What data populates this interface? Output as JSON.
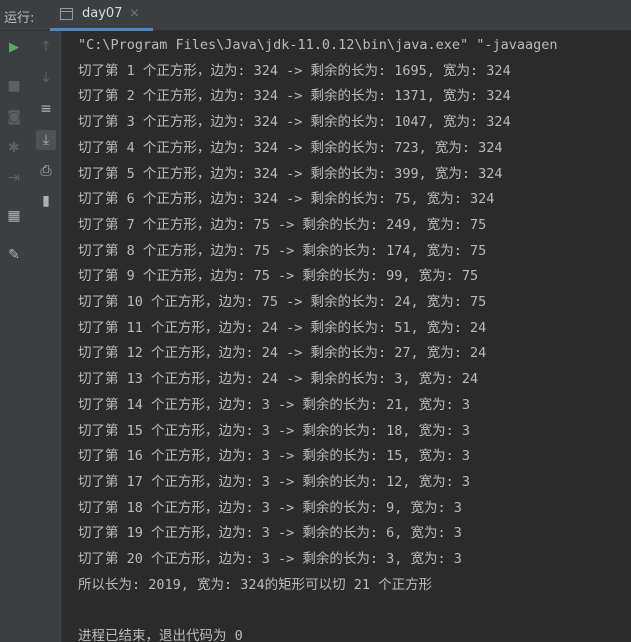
{
  "toolbar": {
    "run_label": "运行:",
    "tab_label": "day07",
    "tab_close": "×",
    "accent": "#4a88c7"
  },
  "icons": {
    "left": [
      "play-icon",
      "stop-icon",
      "camera-icon",
      "bug-icon",
      "exit-icon",
      "layout-icon",
      "pin-icon"
    ],
    "right": [
      "up-arrow-icon",
      "down-arrow-icon",
      "soft-wrap-icon",
      "scroll-to-end-icon",
      "print-icon",
      "trash-icon"
    ]
  },
  "console": {
    "lines": [
      "\"C:\\Program Files\\Java\\jdk-11.0.12\\bin\\java.exe\" \"-javaagen",
      "切了第 1 个正方形，边为: 324 -> 剩余的长为: 1695, 宽为: 324",
      "切了第 2 个正方形，边为: 324 -> 剩余的长为: 1371, 宽为: 324",
      "切了第 3 个正方形，边为: 324 -> 剩余的长为: 1047, 宽为: 324",
      "切了第 4 个正方形，边为: 324 -> 剩余的长为: 723, 宽为: 324",
      "切了第 5 个正方形，边为: 324 -> 剩余的长为: 399, 宽为: 324",
      "切了第 6 个正方形，边为: 324 -> 剩余的长为: 75, 宽为: 324",
      "切了第 7 个正方形，边为: 75 -> 剩余的长为: 249, 宽为: 75",
      "切了第 8 个正方形，边为: 75 -> 剩余的长为: 174, 宽为: 75",
      "切了第 9 个正方形，边为: 75 -> 剩余的长为: 99, 宽为: 75",
      "切了第 10 个正方形，边为: 75 -> 剩余的长为: 24, 宽为: 75",
      "切了第 11 个正方形，边为: 24 -> 剩余的长为: 51, 宽为: 24",
      "切了第 12 个正方形，边为: 24 -> 剩余的长为: 27, 宽为: 24",
      "切了第 13 个正方形，边为: 24 -> 剩余的长为: 3, 宽为: 24",
      "切了第 14 个正方形，边为: 3 -> 剩余的长为: 21, 宽为: 3",
      "切了第 15 个正方形，边为: 3 -> 剩余的长为: 18, 宽为: 3",
      "切了第 16 个正方形，边为: 3 -> 剩余的长为: 15, 宽为: 3",
      "切了第 17 个正方形，边为: 3 -> 剩余的长为: 12, 宽为: 3",
      "切了第 18 个正方形，边为: 3 -> 剩余的长为: 9, 宽为: 3",
      "切了第 19 个正方形，边为: 3 -> 剩余的长为: 6, 宽为: 3",
      "切了第 20 个正方形，边为: 3 -> 剩余的长为: 3, 宽为: 3",
      "所以长为: 2019, 宽为: 324的矩形可以切 21 个正方形",
      "",
      "进程已结束，退出代码为 0"
    ]
  }
}
